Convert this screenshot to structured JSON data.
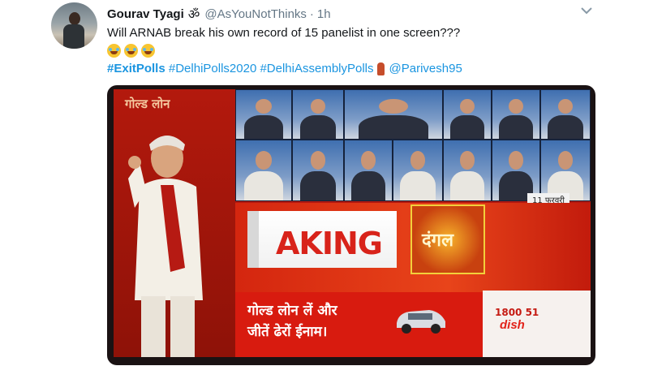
{
  "tweet": {
    "author_name": "Gourav Tyagi",
    "om_symbol": "ॐ",
    "handle": "@AsYouNotThinks",
    "separator": "·",
    "time": "1h",
    "text_line1": "Will ARNAB break his own record of 15 panelist in one screen???",
    "hashtags": [
      "#ExitPolls",
      "#DelhiPolls2020",
      "#DelhiAssemblyPolls"
    ],
    "mention": "@Parivesh95"
  },
  "media": {
    "ad_logo": "गोल्ड लोन",
    "breaking_text": "AKING",
    "dangal_text": "दंगल",
    "loan_line1": "गोल्ड लोन लें और",
    "loan_line2": "जीतें ढेरों ईनाम।",
    "date_tag": "11 फरवरी",
    "dish_number": "1800 51",
    "dish_logo": "dish"
  },
  "icons": {
    "caret": "chevron-down-icon",
    "emoji": "tears-of-joy-emoji",
    "finger": "index-finger-icon"
  },
  "colors": {
    "link": "#1b95e0",
    "secondary": "#657786",
    "news_red": "#d81b0f"
  }
}
